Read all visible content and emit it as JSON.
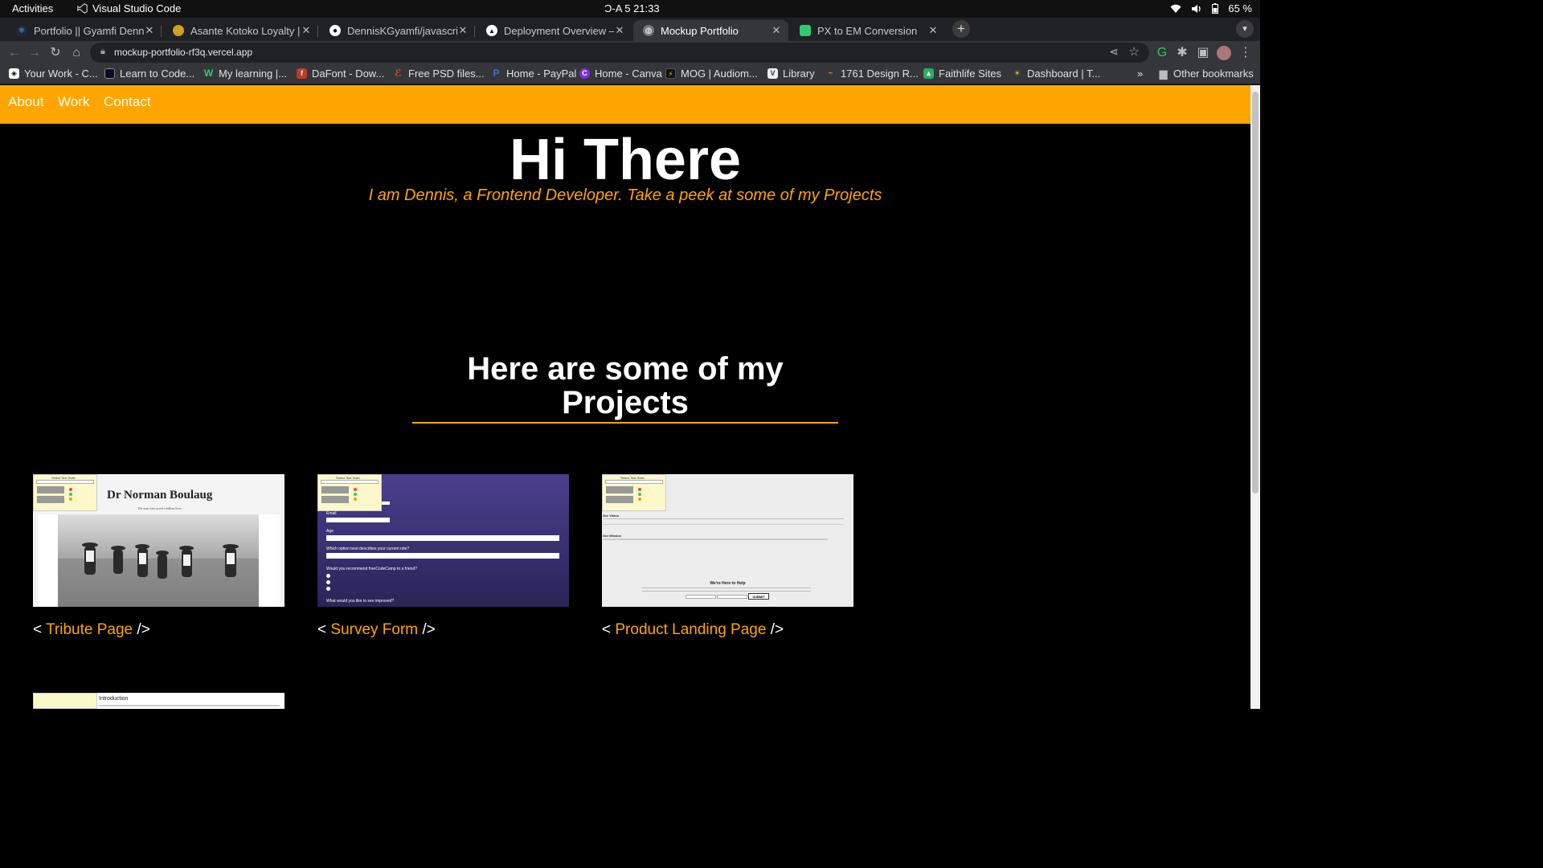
{
  "system_bar": {
    "activities": "Activities",
    "app_name": "Visual Studio Code",
    "clock": "Ɔ-A 5  21:33",
    "battery": "65 %"
  },
  "tabs": [
    {
      "title": "Portfolio || Gyamfi Dennis",
      "icon": "react-icon",
      "color": "#61dafb"
    },
    {
      "title": "Asante Kotoko Loyalty | P",
      "icon": "kotoko-icon",
      "color": "#d4a017"
    },
    {
      "title": "DennisKGyamfi/javascrip",
      "icon": "github-icon",
      "color": "#ffffff"
    },
    {
      "title": "Deployment Overview – D",
      "icon": "vercel-icon",
      "color": "#ffffff"
    },
    {
      "title": "Mockup Portfolio",
      "icon": "globe-icon",
      "color": "#bbbbbb",
      "active": true
    },
    {
      "title": "PX to EM Conversion",
      "icon": "pxtoem-icon",
      "color": "#2ecc71"
    }
  ],
  "address_bar": {
    "url": "mockup-portfolio-rf3q.vercel.app"
  },
  "bookmarks": [
    {
      "label": "Your Work - C...",
      "icon": "codepen-icon",
      "color": "#222"
    },
    {
      "label": "Learn to Code...",
      "icon": "freecodecamp-icon",
      "color": "#0a0a23"
    },
    {
      "label": "My learning |...",
      "icon": "w-icon",
      "color": "#2ecc71"
    },
    {
      "label": "DaFont - Dow...",
      "icon": "dafont-icon",
      "color": "#c0392b"
    },
    {
      "label": "Free PSD files...",
      "icon": "psd-icon",
      "color": "#e74c3c"
    },
    {
      "label": "Home - PayPal",
      "icon": "paypal-icon",
      "color": "#003087"
    },
    {
      "label": "Home - Canva",
      "icon": "canva-icon",
      "color": "#7d2ae8"
    },
    {
      "label": "MOG | Audiom...",
      "icon": "mog-icon",
      "color": "#111"
    },
    {
      "label": "Library",
      "icon": "library-icon",
      "color": "#eeeeee"
    },
    {
      "label": "1761 Design R...",
      "icon": "design-icon",
      "color": "#f39c12"
    },
    {
      "label": "Faithlife Sites",
      "icon": "faithlife-icon",
      "color": "#27ae60"
    },
    {
      "label": "Dashboard | T...",
      "icon": "dashboard-icon",
      "color": "#f1c40f"
    }
  ],
  "bookmarks_more": "»",
  "other_bookmarks": "Other bookmarks",
  "nav": {
    "about": "About",
    "work": "Work",
    "contact": "Contact"
  },
  "hero": {
    "title": "Hi There",
    "subtitle": "I am Dennis, a Frontend Developer. Take a peek at some of my Projects"
  },
  "projects_heading": "Here are some of my Projects",
  "projects": [
    {
      "open": "< ",
      "name": "Tribute Page",
      "close": " />"
    },
    {
      "open": "< ",
      "name": "Survey Form",
      "close": " />"
    },
    {
      "open": "< ",
      "name": "Product Landing Page",
      "close": " />"
    }
  ],
  "tribute_preview": {
    "heading": "Dr Norman Boulaug",
    "caption": "The man who saved a billion lives"
  },
  "survey_preview": {
    "email_label": "Email",
    "age_label": "Age",
    "role_label": "Which option best describes your current role?",
    "recommend_label": "Would you recommend freeCodeCamp to a friend?",
    "improve_label": "What would you like to see improved?"
  },
  "landing_preview": {
    "vision": "Our Vision",
    "mission": "Our Mission",
    "help": "We're Here to Help",
    "submit": "SUBMIT"
  },
  "techdoc_preview": {
    "intro": "Introduction"
  },
  "test_suite": {
    "title": "Select Test Suite",
    "run": "Run Tests",
    "tests": "Tests"
  },
  "colors": {
    "accent": "#ffa500",
    "background": "#000000"
  }
}
